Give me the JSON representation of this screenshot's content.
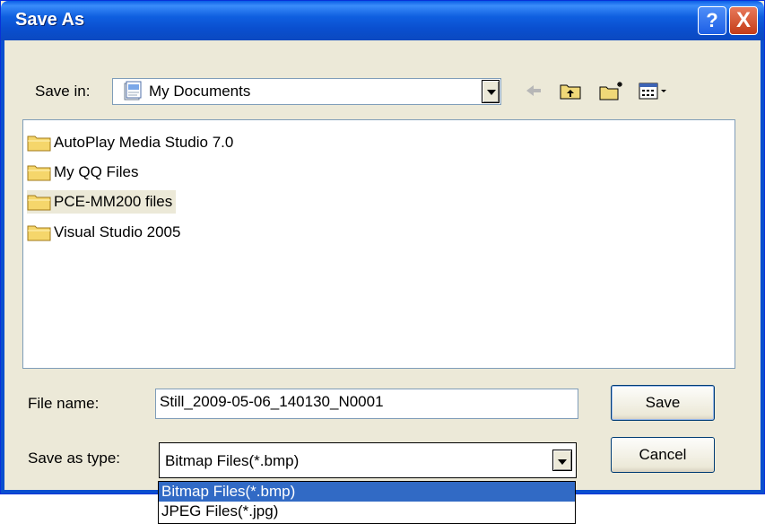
{
  "window": {
    "title": "Save As",
    "help_label": "?",
    "close_label": "X"
  },
  "save_in": {
    "label": "Save in:",
    "value": "My Documents"
  },
  "toolbar": {
    "icons": [
      "back-arrow-icon",
      "up-folder-icon",
      "new-folder-icon",
      "view-menu-icon"
    ]
  },
  "files": [
    {
      "name": "AutoPlay Media Studio 7.0",
      "selected": false
    },
    {
      "name": "My QQ Files",
      "selected": false
    },
    {
      "name": "PCE-MM200 files",
      "selected": true
    },
    {
      "name": "Visual Studio 2005",
      "selected": false
    }
  ],
  "file_name": {
    "label": "File name:",
    "value": "Still_2009-05-06_140130_N0001"
  },
  "save_as_type": {
    "label": "Save as type:",
    "value": "Bitmap Files(*.bmp)",
    "options": [
      "Bitmap Files(*.bmp)",
      "JPEG Files(*.jpg)"
    ],
    "selected_index": 0
  },
  "buttons": {
    "save": "Save",
    "cancel": "Cancel"
  },
  "colors": {
    "title_bar": "#0a5ee6",
    "dialog_bg": "#ece9d8",
    "selection": "#316ac5",
    "close_button": "#c43c18"
  }
}
